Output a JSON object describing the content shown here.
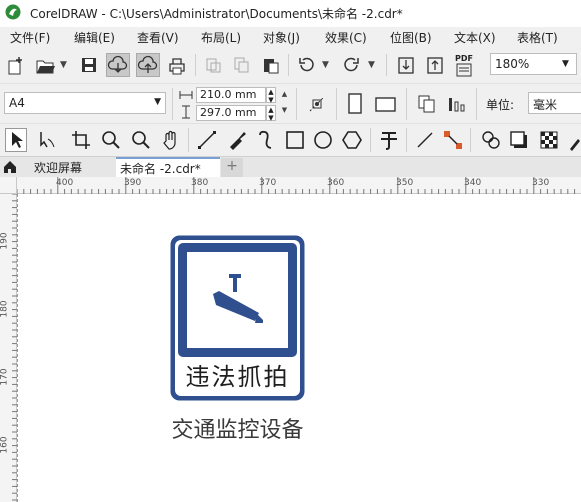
{
  "window": {
    "title": "CorelDRAW - C:\\Users\\Administrator\\Documents\\未命名 -2.cdr*"
  },
  "menu": [
    "文件(F)",
    "编辑(E)",
    "查看(V)",
    "布局(L)",
    "对象(J)",
    "效果(C)",
    "位图(B)",
    "文本(X)",
    "表格(T)"
  ],
  "toolbar": {
    "zoom_value": "180%",
    "pdf_label": "PDF"
  },
  "propbar": {
    "page_size": "A4",
    "width": "210.0 mm",
    "height": "297.0 mm",
    "unit_label": "单位:",
    "unit_value": "毫米"
  },
  "tabs": [
    {
      "label": "欢迎屏幕",
      "active": false
    },
    {
      "label": "未命名 -2.cdr*",
      "active": true
    }
  ],
  "ruler": {
    "h_labels": [
      "400",
      "390",
      "380",
      "370",
      "360",
      "350",
      "340",
      "330"
    ],
    "v_labels": [
      "190",
      "180",
      "170",
      "160"
    ]
  },
  "sign": {
    "main_text": "违法抓拍",
    "caption": "交通监控设备",
    "color": "#2f4f8f"
  }
}
